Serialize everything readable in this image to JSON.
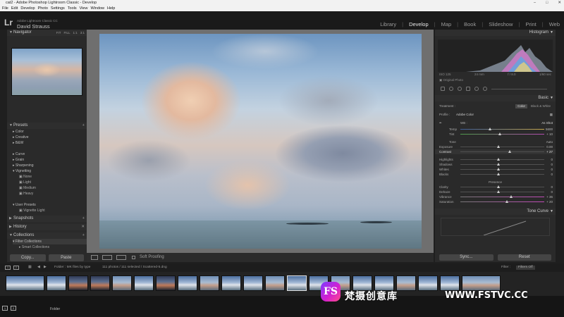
{
  "window": {
    "title": "cat2 - Adobe Photoshop Lightroom Classic - Develop"
  },
  "menu": [
    "File",
    "Edit",
    "Develop",
    "Photo",
    "Settings",
    "Tools",
    "View",
    "Window",
    "Help"
  ],
  "identity": {
    "logo": "Lr",
    "app": "Adobe Lightroom Classic CC",
    "user": "David Strauss"
  },
  "modules": [
    "Library",
    "Develop",
    "Map",
    "Book",
    "Slideshow",
    "Print",
    "Web"
  ],
  "active_module": "Develop",
  "left": {
    "navigator": {
      "label": "Navigator",
      "opts": [
        "FIT",
        "FILL",
        "1:1",
        "3:1"
      ]
    },
    "presets": {
      "label": "Presets",
      "groups_a": [
        "Color",
        "Creative",
        "B&W"
      ],
      "groups_b": [
        "Curve",
        "Grain",
        "Sharpening",
        "Vignetting"
      ],
      "vignetting_items": [
        "None",
        "Light",
        "Medium",
        "Heavy"
      ],
      "user": "User Presets",
      "user_items": [
        "Vignette Light"
      ]
    },
    "snapshots": "Snapshots",
    "history": "History",
    "collections": {
      "label": "Collections",
      "items": [
        "Filter Collections",
        "Smart Collections"
      ]
    },
    "copy": "Copy...",
    "paste": "Paste"
  },
  "toolbar": {
    "soft_proofing": "Soft Proofing"
  },
  "right": {
    "histogram": "Histogram",
    "histo_info": [
      "ISO 125",
      "24 mm",
      "f / 8.0",
      "1/60 sec"
    ],
    "original_photo": "Original Photo",
    "basic": "Basic",
    "treatment": {
      "label": "Treatment :",
      "color": "Color",
      "bw": "Black & White"
    },
    "profile": {
      "label": "Profile :",
      "value": "Adobe Color"
    },
    "wb": {
      "label": "WB :",
      "value": "As Shot"
    },
    "temp": {
      "label": "Temp",
      "value": "5600"
    },
    "tint": {
      "label": "Tint",
      "value": "+ 10"
    },
    "tone": {
      "label": "Tone",
      "auto": "Auto"
    },
    "exposure": {
      "label": "Exposure",
      "value": "0.00"
    },
    "contrast": {
      "label": "Contrast",
      "value": "+ 27"
    },
    "highlights": {
      "label": "Highlights",
      "value": "0"
    },
    "shadows": {
      "label": "Shadows",
      "value": "0"
    },
    "whites": {
      "label": "Whites",
      "value": "0"
    },
    "blacks": {
      "label": "Blacks",
      "value": "0"
    },
    "presence": "Presence",
    "clarity": {
      "label": "Clarity",
      "value": "0"
    },
    "dehaze": {
      "label": "Dehaze",
      "value": "0"
    },
    "vibrance": {
      "label": "Vibrance",
      "value": "+ 36"
    },
    "saturation": {
      "label": "Saturation",
      "value": "+ 20"
    },
    "tone_curve": "Tone Curve",
    "sync": "Sync...",
    "reset": "Reset"
  },
  "filmstrip_bar": {
    "source": "Folder : MK files by type",
    "count": "111 photos / 111 selected / Scattered-5.dng",
    "filter_label": "Filter :",
    "filter_value": "Filters Off"
  },
  "bottom": {
    "folder": "Folder"
  },
  "watermark": {
    "logo": "FS",
    "text": "梵摄创意库",
    "url": "WWW.FSTVC.CC"
  },
  "colors": {
    "accent": "#e8e8e8",
    "panel": "#2a2a2a"
  }
}
